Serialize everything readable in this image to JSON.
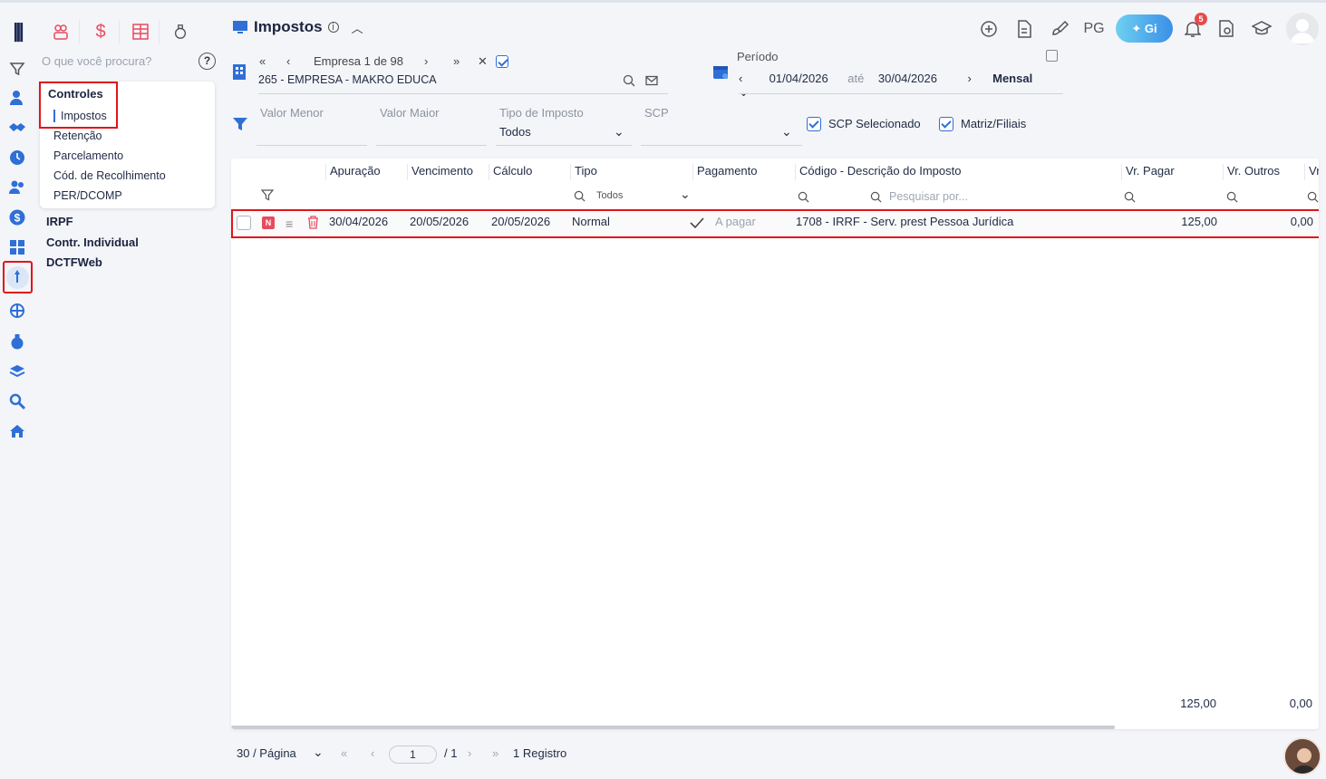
{
  "app": {
    "search_placeholder": "O que você procura?",
    "help_label": "?"
  },
  "submenu": {
    "header": "Controles",
    "items": [
      "Impostos",
      "Retenção",
      "Parcelamento",
      "Cód. de Recolhimento",
      "PER/DCOMP"
    ],
    "active_item": "Impostos"
  },
  "menu_groups": [
    "IRPF",
    "Contr. Individual",
    "DCTFWeb"
  ],
  "header": {
    "title": "Impostos",
    "right_text": "PG",
    "gi_label": "Gi",
    "notification_count": "5"
  },
  "company": {
    "nav_label": "Empresa 1 de 98",
    "name": "265 - EMPRESA - MAKRO EDUCA"
  },
  "periodo": {
    "label": "Período",
    "start": "01/04/2026",
    "between": "até",
    "end": "30/04/2026",
    "mode": "Mensal"
  },
  "filters": {
    "valor_menor": "Valor Menor",
    "valor_maior": "Valor Maior",
    "tipo_imposto_label": "Tipo de Imposto",
    "tipo_imposto_value": "Todos",
    "scp_label": "SCP",
    "scp_selecionado": "SCP Selecionado",
    "matriz_filiais": "Matriz/Filiais"
  },
  "table": {
    "columns": [
      "Apuração",
      "Vencimento",
      "Cálculo",
      "Tipo",
      "Pagamento",
      "Código - Descrição do Imposto",
      "Vr. Pagar",
      "Vr. Outros",
      "Vr"
    ],
    "tipo_filter": "Todos",
    "desc_filter_placeholder": "Pesquisar por...",
    "rows": [
      {
        "badge": "N",
        "apuracao": "30/04/2026",
        "vencimento": "20/05/2026",
        "calculo": "20/05/2026",
        "tipo": "Normal",
        "pagamento": "A pagar",
        "descricao": "1708 - IRRF - Serv. prest Pessoa Jurídica",
        "vr_pagar": "125,00",
        "vr_outros": "0,00"
      }
    ],
    "totals": {
      "vr_pagar": "125,00",
      "vr_outros": "0,00"
    }
  },
  "pager": {
    "per_page": "30 / Página",
    "page": "1",
    "of": "/ 1",
    "records": "1 Registro"
  },
  "colors": {
    "accent": "#2f6fd6",
    "highlight": "#e0141b",
    "brand_red": "#e84a5f"
  }
}
